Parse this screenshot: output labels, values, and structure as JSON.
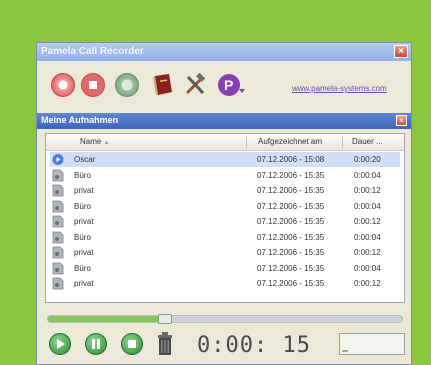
{
  "window": {
    "title": "Pamela Call Recorder",
    "close": "×",
    "link": "www.pamela-systems.com"
  },
  "toolbar": {
    "buttons": [
      {
        "icon": "record-icon"
      },
      {
        "icon": "stop-icon"
      },
      {
        "icon": "search-icon"
      },
      {
        "icon": "book-icon"
      },
      {
        "icon": "tools-icon"
      },
      {
        "icon": "pamela-logo-icon"
      }
    ]
  },
  "section": {
    "title": "Meine Aufnahmen",
    "close": "×"
  },
  "table": {
    "columns": [
      "Name",
      "Aufgezeichnet am",
      "Dauer ..."
    ],
    "sort_indicator": "▲",
    "rows": [
      {
        "name": "Oscar",
        "date": "07.12.2006 - 15:08",
        "duration": "0:00:20",
        "selected": true
      },
      {
        "name": "Büro",
        "date": "07.12.2006 - 15:35",
        "duration": "0:00:04"
      },
      {
        "name": "privat",
        "date": "07.12.2006 - 15:35",
        "duration": "0:00:12"
      },
      {
        "name": "Büro",
        "date": "07.12.2006 - 15:35",
        "duration": "0:00:04"
      },
      {
        "name": "privat",
        "date": "07.12.2006 - 15:35",
        "duration": "0:00:12"
      },
      {
        "name": "Büro",
        "date": "07.12.2006 - 15:35",
        "duration": "0:00:04"
      },
      {
        "name": "privat",
        "date": "07.12.2006 - 15:35",
        "duration": "0:00:12"
      },
      {
        "name": "Büro",
        "date": "07.12.2006 - 15:35",
        "duration": "0:00:04"
      },
      {
        "name": "privat",
        "date": "07.12.2006 - 15:35",
        "duration": "0:00:12"
      }
    ]
  },
  "player": {
    "progress": 0.33,
    "time": "0:00: 15",
    "level": 0.1
  },
  "colors": {
    "background": "#8cc63f",
    "accent": "#3d64b8",
    "play": "#2c8c3a"
  }
}
